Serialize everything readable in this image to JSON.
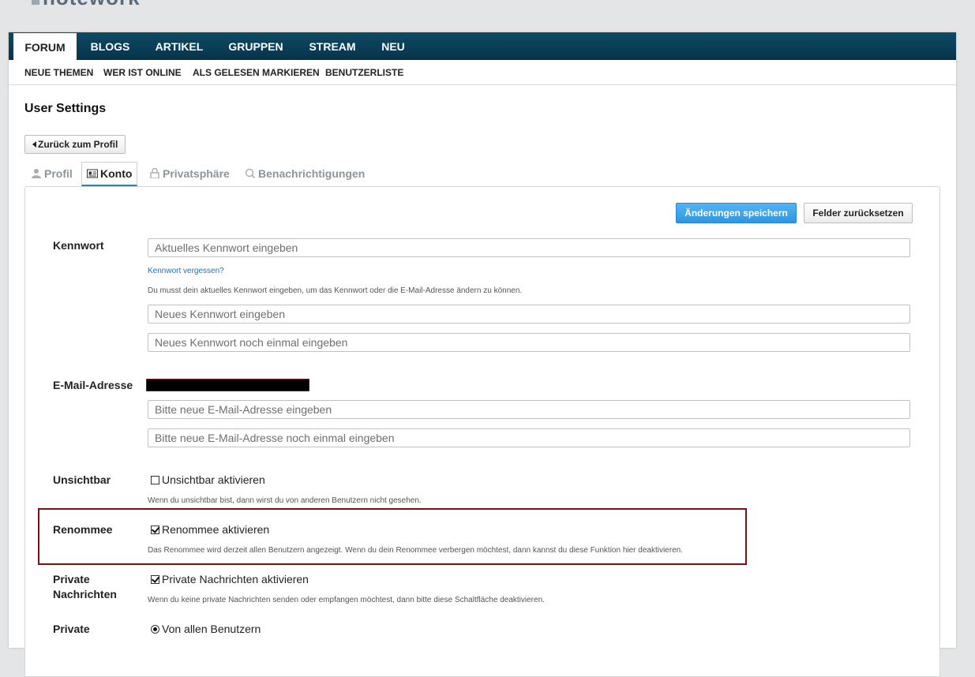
{
  "top_nav": {
    "tabs": [
      {
        "label": "FORUM",
        "active": true
      },
      {
        "label": "BLOGS",
        "active": false
      },
      {
        "label": "ARTIKEL",
        "active": false
      },
      {
        "label": "GRUPPEN",
        "active": false
      },
      {
        "label": "STREAM",
        "active": false
      },
      {
        "label": "NEU",
        "active": false
      }
    ]
  },
  "sub_nav": {
    "items": [
      "NEUE THEMEN",
      "WER IST ONLINE",
      "ALS GELESEN MARKIEREN",
      "BENUTZERLISTE"
    ]
  },
  "page": {
    "title": "User Settings",
    "back_label": "Zurück zum Profil"
  },
  "profile_tabs": [
    {
      "label": "Profil",
      "icon": "user-icon",
      "active": false
    },
    {
      "label": "Konto",
      "icon": "id-card-icon",
      "active": true
    },
    {
      "label": "Privatsphäre",
      "icon": "lock-icon",
      "active": false
    },
    {
      "label": "Benachrichtigungen",
      "icon": "bell-icon",
      "active": false
    }
  ],
  "actions": {
    "save_label": "Änderungen speichern",
    "reset_label": "Felder zurücksetzen"
  },
  "password": {
    "label": "Kennwort",
    "current_placeholder": "Aktuelles Kennwort eingeben",
    "forgot_link": "Kennwort vergessen?",
    "hint": "Du musst dein aktuelles Kennwort eingeben, um das Kennwort oder die E-Mail-Adresse ändern zu können.",
    "new_placeholder": "Neues Kennwort eingeben",
    "repeat_placeholder": "Neues Kennwort noch einmal eingeben"
  },
  "email": {
    "label": "E-Mail-Adresse",
    "new_placeholder": "Bitte neue E-Mail-Adresse eingeben",
    "repeat_placeholder": "Bitte neue E-Mail-Adresse noch einmal eingeben"
  },
  "invisible": {
    "label": "Unsichtbar",
    "checkbox_label": "Unsichtbar aktivieren",
    "checked": false,
    "hint": "Wenn du unsichtbar bist, dann wirst du von anderen Benutzern nicht gesehen."
  },
  "reputation": {
    "label": "Renommee",
    "checkbox_label": "Renommee aktivieren",
    "checked": true,
    "hint": "Das Renommee wird derzeit allen Benutzern angezeigt. Wenn du dein Renommee verbergen möchtest, dann kannst du diese Funktion hier deaktivieren."
  },
  "private_messages": {
    "label_line1": "Private",
    "label_line2": "Nachrichten",
    "checkbox_label": "Private Nachrichten aktivieren",
    "checked": true,
    "hint": "Wenn du keine private Nachrichten senden oder empfangen möchtest, dann bitte diese Schaltfläche deaktivieren."
  },
  "private_from": {
    "label": "Private",
    "radio_label": "Von allen Benutzern",
    "selected": true
  },
  "colors": {
    "nav_bar": "#0a3f57",
    "save_button": "#3aa3ea",
    "highlight_border": "#7a1111",
    "link": "#1f72b3"
  }
}
